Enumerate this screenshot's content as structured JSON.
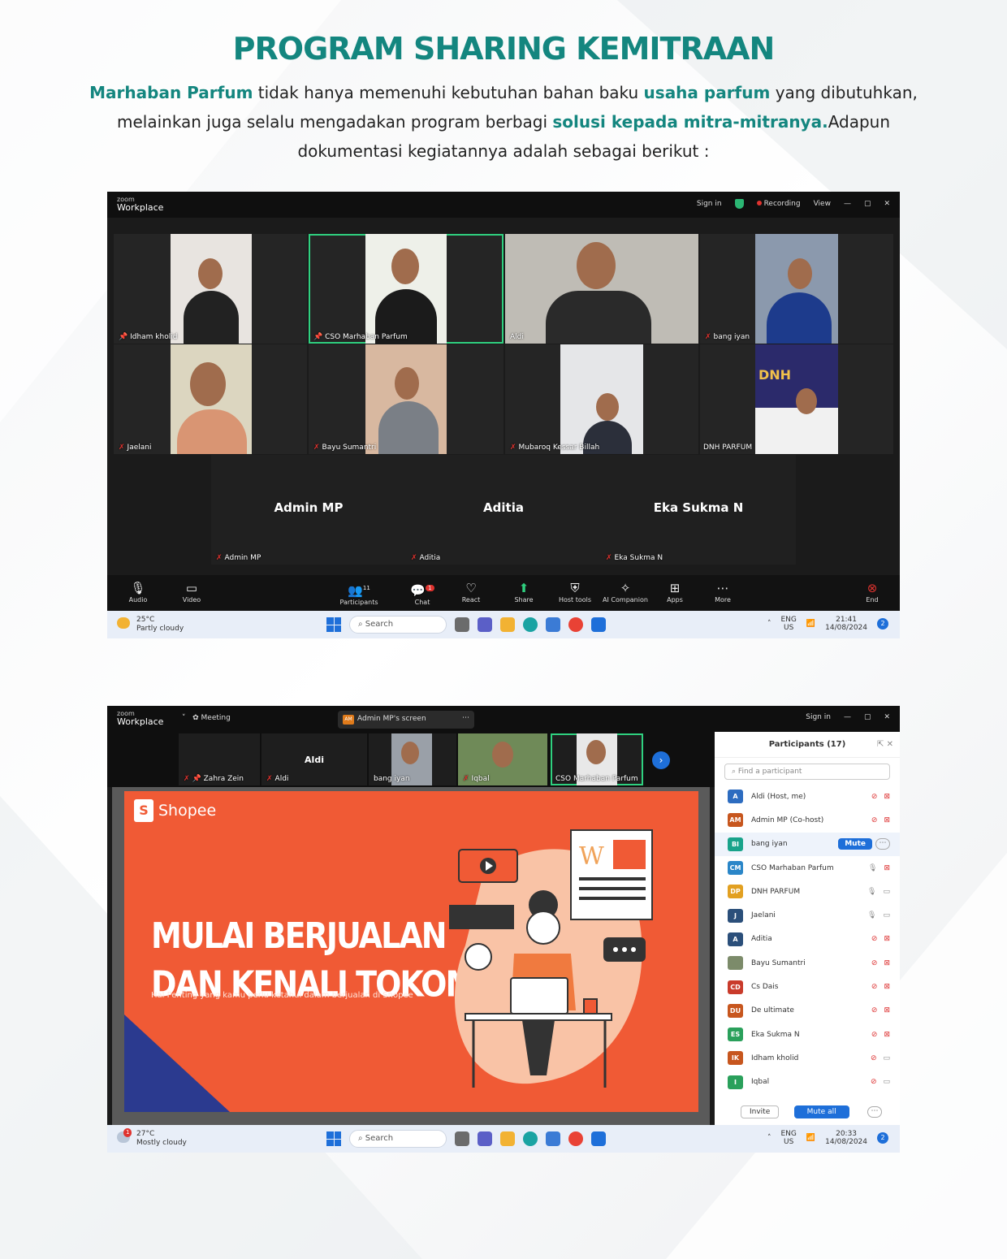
{
  "heading": "PROGRAM SHARING KEMITRAAN",
  "intro": {
    "p1_brand": "Marhaban Parfum",
    "p1_text": " tidak hanya memenuhi kebutuhan bahan baku ",
    "p1_bold": "usaha parfum",
    "p1_tail": " yang dibutuhkan,",
    "p2_text": "melainkan juga selalu mengadakan program berbagi ",
    "p2_bold": "solusi kepada mitra-mitranya.",
    "p2_tail": "Adapun",
    "p3_text": "dokumentasi kegiatannya adalah sebagai berikut :"
  },
  "zoom1": {
    "app_small": "zoom",
    "app_name": "Workplace",
    "sign_in": "Sign in",
    "recording": "Recording",
    "view": "View",
    "tiles": [
      "Idham kholid",
      "CSO Marhaban Parfum",
      "Aldi",
      "bang iyan",
      "Jaelani",
      "Bayu Sumantri",
      "Mubaroq Kessar Billah",
      "DNH PARFUM"
    ],
    "name_tiles": [
      {
        "big": "Admin MP",
        "small": "Admin MP"
      },
      {
        "big": "Aditia",
        "small": "Aditia"
      },
      {
        "big": "Eka Sukma N",
        "small": "Eka Sukma N"
      }
    ],
    "toolbar": [
      "Audio",
      "Video",
      "Participants",
      "Chat",
      "React",
      "Share",
      "Host tools",
      "AI Companion",
      "Apps",
      "More",
      "End"
    ],
    "participants_count": "11",
    "chat_badge": "1",
    "taskbar": {
      "temp": "25°C",
      "weather": "Partly cloudy",
      "search": "Search",
      "lang1": "ENG",
      "lang2": "US",
      "time": "21:41",
      "date": "14/08/2024",
      "badge": "2"
    }
  },
  "zoom2": {
    "app_small": "zoom",
    "app_name": "Workplace",
    "meeting": "Meeting",
    "screen_label": "Admin MP's screen",
    "sign_in": "Sign in",
    "strip": [
      "Zahra Zein",
      "Aldi",
      "bang iyan",
      "Iqbal",
      "CSO Marhaban Parfum"
    ],
    "strip_big": "Aldi",
    "slide": {
      "brand": "Shopee",
      "line1": "MULAI BERJUALAN",
      "line2": "DAN KENALI TOKOMU",
      "sub": "Hal Penting yang kamu perlu ketahui dalam berjualan di Shopee",
      "letter_w": "W"
    },
    "panel": {
      "title": "Participants (17)",
      "find": "Find a participant",
      "mute_label": "Mute",
      "invite": "Invite",
      "mute_all": "Mute all",
      "rows": [
        {
          "initials": "A",
          "name": "Aldi (Host, me)",
          "color": "#2d6cc0"
        },
        {
          "initials": "AM",
          "name": "Admin MP (Co-host)",
          "color": "#c7561e"
        },
        {
          "initials": "BI",
          "name": "bang iyan",
          "color": "#19a38a"
        },
        {
          "initials": "CM",
          "name": "CSO Marhaban Parfum",
          "color": "#2a86c8"
        },
        {
          "initials": "DP",
          "name": "DNH PARFUM",
          "color": "#e2a021"
        },
        {
          "initials": "J",
          "name": "Jaelani",
          "color": "#2b4f7a"
        },
        {
          "initials": "A",
          "name": "Aditia",
          "color": "#2b4f7a"
        },
        {
          "initials": "",
          "name": "Bayu Sumantri",
          "color": "#7c8b6a"
        },
        {
          "initials": "CD",
          "name": "Cs Dais",
          "color": "#c93b2b"
        },
        {
          "initials": "DU",
          "name": "De ultimate",
          "color": "#c7561e"
        },
        {
          "initials": "ES",
          "name": "Eka Sukma N",
          "color": "#2aa05b"
        },
        {
          "initials": "IK",
          "name": "Idham kholid",
          "color": "#c7561e"
        },
        {
          "initials": "I",
          "name": "Iqbal",
          "color": "#2aa05b"
        }
      ]
    },
    "taskbar": {
      "notif": "1",
      "temp": "27°C",
      "weather": "Mostly cloudy",
      "search": "Search",
      "lang1": "ENG",
      "lang2": "US",
      "time": "20:33",
      "date": "14/08/2024",
      "badge": "2"
    }
  }
}
